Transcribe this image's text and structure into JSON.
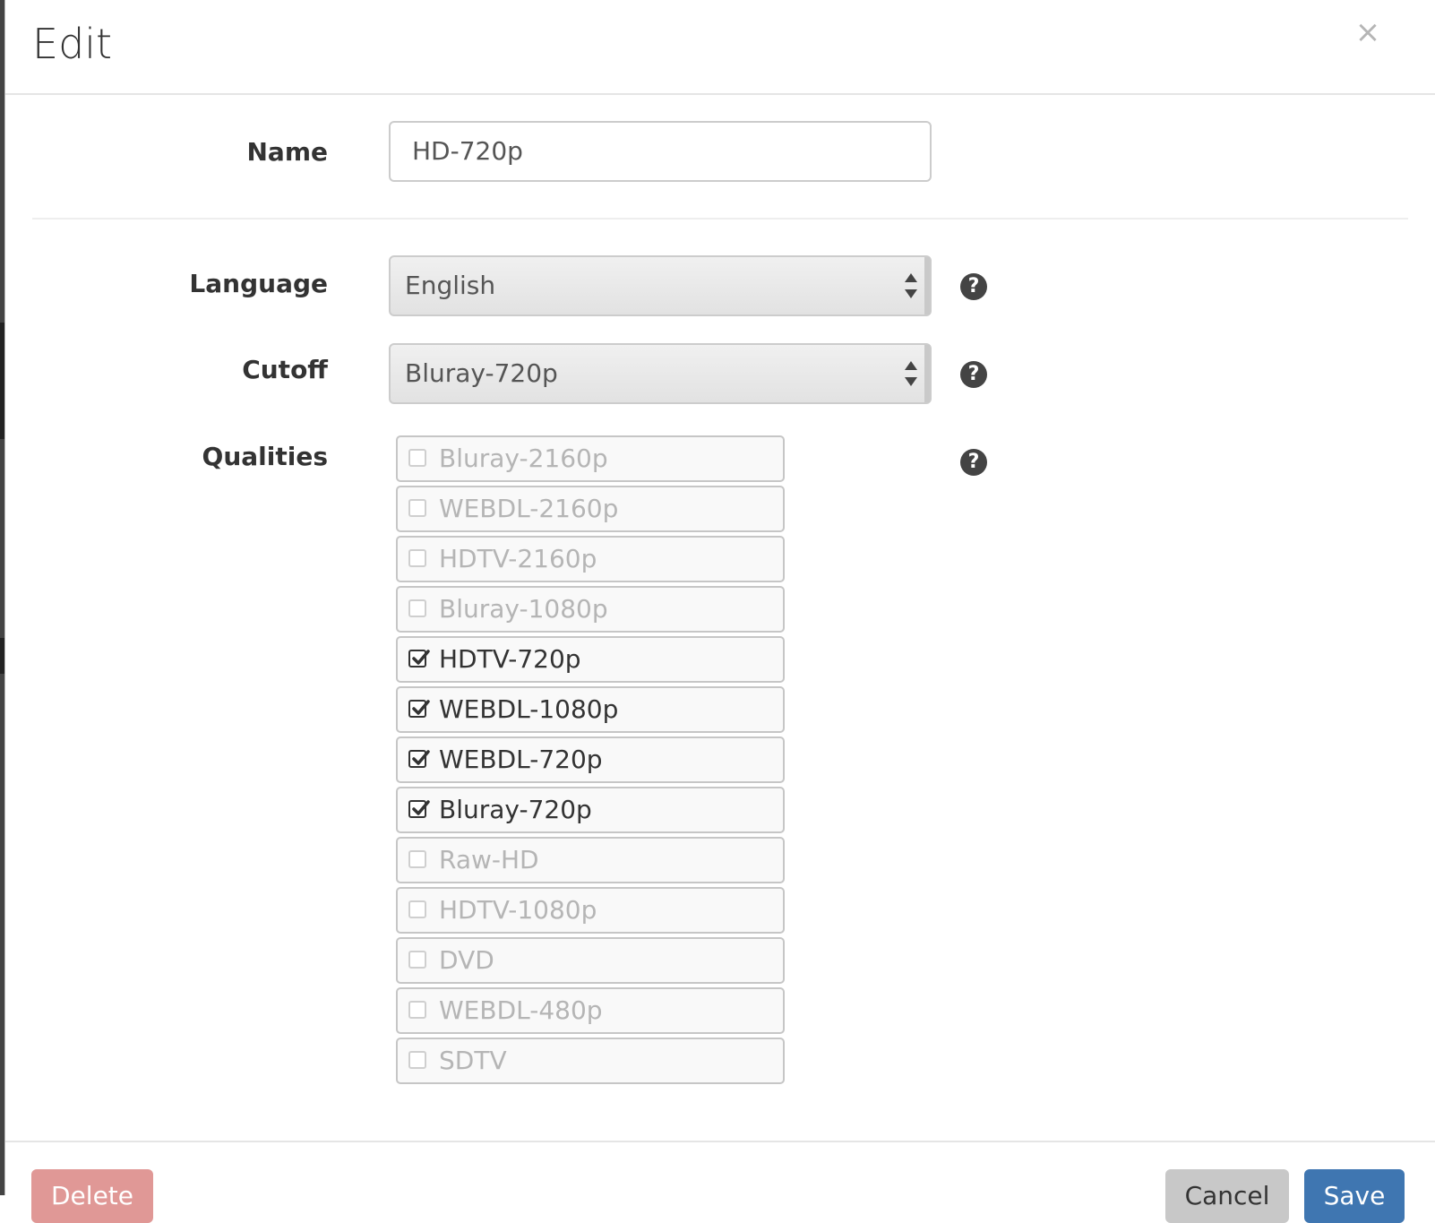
{
  "modal": {
    "title": "Edit",
    "close_label": "×"
  },
  "form": {
    "name_label": "Name",
    "name_value": "HD-720p",
    "language_label": "Language",
    "language_value": "English",
    "cutoff_label": "Cutoff",
    "cutoff_value": "Bluray-720p",
    "qualities_label": "Qualities",
    "help_glyph": "?"
  },
  "qualities": [
    {
      "label": "Bluray-2160p",
      "checked": false
    },
    {
      "label": "WEBDL-2160p",
      "checked": false
    },
    {
      "label": "HDTV-2160p",
      "checked": false
    },
    {
      "label": "Bluray-1080p",
      "checked": false
    },
    {
      "label": "HDTV-720p",
      "checked": true
    },
    {
      "label": "WEBDL-1080p",
      "checked": true
    },
    {
      "label": "WEBDL-720p",
      "checked": true
    },
    {
      "label": "Bluray-720p",
      "checked": true
    },
    {
      "label": "Raw-HD",
      "checked": false
    },
    {
      "label": "HDTV-1080p",
      "checked": false
    },
    {
      "label": "DVD",
      "checked": false
    },
    {
      "label": "WEBDL-480p",
      "checked": false
    },
    {
      "label": "SDTV",
      "checked": false
    }
  ],
  "footer": {
    "delete_label": "Delete",
    "cancel_label": "Cancel",
    "save_label": "Save"
  },
  "colors": {
    "delete": "#e09896",
    "cancel": "#c8c8c8",
    "save": "#3f76b1"
  },
  "icons": {
    "close": "close-icon",
    "help": "question-circle-icon",
    "select": "sort-arrows-icon",
    "check": "check-square-icon"
  }
}
